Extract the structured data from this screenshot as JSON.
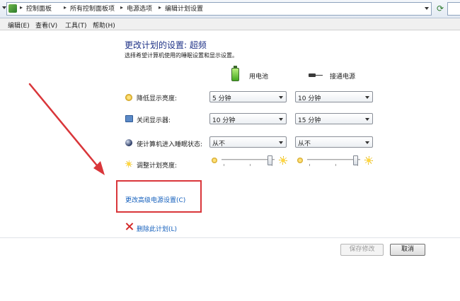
{
  "address_bar": {
    "breadcrumbs": [
      "控制面板",
      "所有控制面板项",
      "电源选项",
      "编辑计划设置"
    ]
  },
  "menu": {
    "items": [
      "编辑(E)",
      "查看(V)",
      "工具(T)",
      "帮助(H)"
    ]
  },
  "header": {
    "title": "更改计划的设置: 超频",
    "subtitle": "选择希望计算机使用的睡眠设置和显示设置。"
  },
  "columns": {
    "battery": "用电池",
    "plugged": "接通电源"
  },
  "settings": [
    {
      "icon": "dim-display-icon",
      "label": "降低显示亮度:",
      "battery": "5 分钟",
      "plugged": "10 分钟"
    },
    {
      "icon": "monitor-icon",
      "label": "关闭显示器:",
      "battery": "10 分钟",
      "plugged": "15 分钟"
    },
    {
      "icon": "sleep-icon",
      "label": "使计算机进入睡眠状态:",
      "battery": "从不",
      "plugged": "从不"
    }
  ],
  "brightness": {
    "label": "调整计划亮度:",
    "battery_level": 0.95,
    "plugged_level": 0.95
  },
  "links": {
    "advanced": "更改高级电源设置(C)",
    "delete": "删除此计划(L)"
  },
  "buttons": {
    "save": "保存修改",
    "cancel": "取消"
  },
  "colors": {
    "title": "#1e3287",
    "link": "#1560bd",
    "highlight": "#d9363a"
  }
}
